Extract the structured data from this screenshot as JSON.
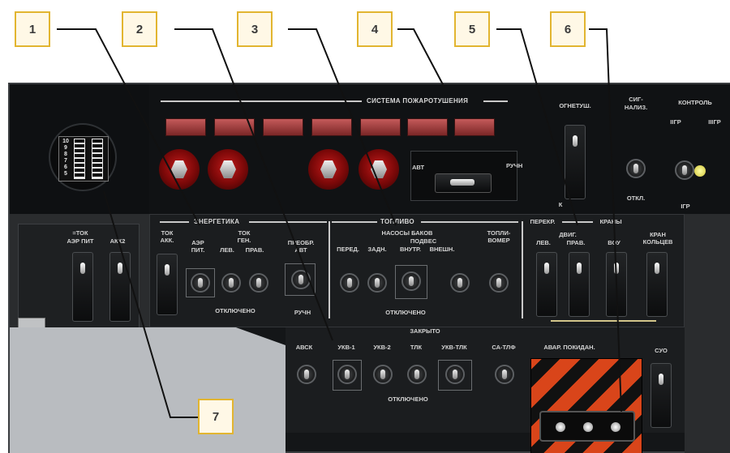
{
  "callouts": [
    "1",
    "2",
    "3",
    "4",
    "5",
    "6",
    "7"
  ],
  "fire_system": {
    "title": "СИСТЕМА ПОЖАРОТУШЕНИЯ",
    "mode_left": "АВТ",
    "mode_right": "РУЧН",
    "extinguisher_label": "ОГНЕТУШ.",
    "extinguisher_k": "К",
    "alarm_label_1": "СИГ-",
    "alarm_label_2": "НАЛИЗ.",
    "alarm_off": "ОТКЛ.",
    "control_title": "КОНТРОЛЬ",
    "control_gr2": "IIГР",
    "control_gr3": "IIIГР",
    "control_gr1": "IГР"
  },
  "gauge": {
    "scale": [
      "10",
      "9",
      "8",
      "7",
      "6",
      "5"
    ]
  },
  "left_panel": {
    "title_1": "=ТОК",
    "title_2": "АЭР ПИТ",
    "akk2": "АКК2"
  },
  "energetics": {
    "title": "ЭНЕРГЕТИКА",
    "tok_akk_1": "ТОК",
    "tok_akk_2": "АКК.",
    "tok_gen_1": "ТОК",
    "tok_gen_2": "ГЕН.",
    "aer_pit_1": "АЭР",
    "aer_pit_2": "ПИТ.",
    "lev": "ЛЕВ.",
    "prav": "ПРАВ.",
    "preobr_1": "ПРЕОБР.",
    "preobr_2": "АВТ",
    "otkl": "ОТКЛЮЧЕНО",
    "ruchn": "РУЧН"
  },
  "fuel": {
    "title": "ТОПЛИВО",
    "pumps_title": "НАСОСЫ БАКОВ",
    "podves": "ПОДВЕС",
    "pered": "ПЕРЕД.",
    "zadn": "ЗАДН.",
    "vnutr": "ВНУТР.",
    "vnesh": "ВНЕШН.",
    "toplivomer_1": "ТОПЛИ-",
    "toplivomer_2": "ВОМЕР",
    "otkl": "ОТКЛЮЧЕНО"
  },
  "valves": {
    "title_1": "ПЕРЕКР.",
    "title_2": "КРАНЫ",
    "dvig_1": "ДВИГ.",
    "lev": "ЛЕВ.",
    "prav": "ПРАВ.",
    "vou": "ВОУ",
    "kran_1": "КРАН",
    "kran_2": "КОЛЬЦЕВ",
    "zakryto": "ЗАКРЫТО"
  },
  "radio": {
    "items": [
      "АВСК",
      "УКВ-1",
      "УКВ-2",
      "ТЛК",
      "УКВ-ТЛК",
      "СА-ТЛФ"
    ],
    "otkl": "ОТКЛЮЧЕНО",
    "avar": "АВАР. ПОКИДАН.",
    "suo": "СУО"
  },
  "colors": {
    "callout_border": "#e2b530",
    "fire_red": "#c11a1a",
    "hatch_orange": "#d9451a"
  }
}
